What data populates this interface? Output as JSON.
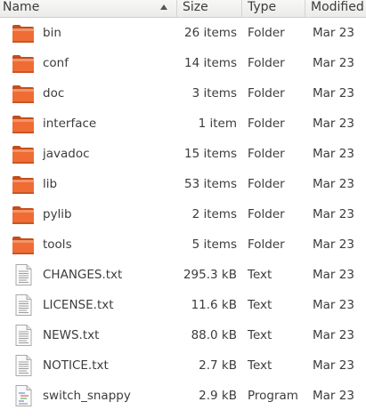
{
  "columns": {
    "name": "Name",
    "size": "Size",
    "type": "Type",
    "modified": "Modified"
  },
  "sort": {
    "column": "name",
    "direction": "ascending",
    "icon": "sort-ascending-icon"
  },
  "colors": {
    "folder": "#ef6c35",
    "header_bg": "#f0efed",
    "text": "#3c3c3c"
  },
  "files": [
    {
      "name": "bin",
      "size": "26 items",
      "type": "Folder",
      "modified": "Mar 23",
      "icon": "folder-icon"
    },
    {
      "name": "conf",
      "size": "14 items",
      "type": "Folder",
      "modified": "Mar 23",
      "icon": "folder-icon"
    },
    {
      "name": "doc",
      "size": "3 items",
      "type": "Folder",
      "modified": "Mar 23",
      "icon": "folder-icon"
    },
    {
      "name": "interface",
      "size": "1 item",
      "type": "Folder",
      "modified": "Mar 23",
      "icon": "folder-icon"
    },
    {
      "name": "javadoc",
      "size": "15 items",
      "type": "Folder",
      "modified": "Mar 23",
      "icon": "folder-icon"
    },
    {
      "name": "lib",
      "size": "53 items",
      "type": "Folder",
      "modified": "Mar 23",
      "icon": "folder-icon"
    },
    {
      "name": "pylib",
      "size": "2 items",
      "type": "Folder",
      "modified": "Mar 23",
      "icon": "folder-icon"
    },
    {
      "name": "tools",
      "size": "5 items",
      "type": "Folder",
      "modified": "Mar 23",
      "icon": "folder-icon"
    },
    {
      "name": "CHANGES.txt",
      "size": "295.3 kB",
      "type": "Text",
      "modified": "Mar 23",
      "icon": "text-file-icon"
    },
    {
      "name": "LICENSE.txt",
      "size": "11.6 kB",
      "type": "Text",
      "modified": "Mar 23",
      "icon": "text-file-icon"
    },
    {
      "name": "NEWS.txt",
      "size": "88.0 kB",
      "type": "Text",
      "modified": "Mar 23",
      "icon": "text-file-icon"
    },
    {
      "name": "NOTICE.txt",
      "size": "2.7 kB",
      "type": "Text",
      "modified": "Mar 23",
      "icon": "text-file-icon"
    },
    {
      "name": "switch_snappy",
      "size": "2.9 kB",
      "type": "Program",
      "modified": "Mar 23",
      "icon": "script-file-icon"
    }
  ]
}
